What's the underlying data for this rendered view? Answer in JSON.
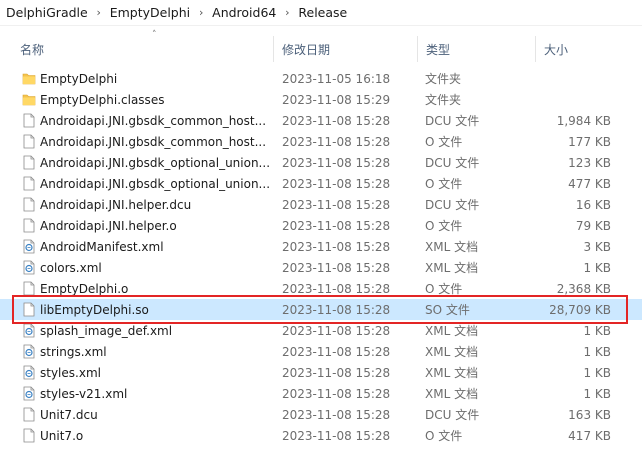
{
  "breadcrumb": [
    "DelphiGradle",
    "EmptyDelphi",
    "Android64",
    "Release"
  ],
  "columns": {
    "name": "名称",
    "date": "修改日期",
    "type": "类型",
    "size": "大小"
  },
  "files": [
    {
      "name": "EmptyDelphi",
      "date": "2023-11-05 16:18",
      "type": "文件夹",
      "size": "",
      "icon": "folder-icon"
    },
    {
      "name": "EmptyDelphi.classes",
      "date": "2023-11-08 15:29",
      "type": "文件夹",
      "size": "",
      "icon": "folder-icon"
    },
    {
      "name": "Androidapi.JNI.gbsdk_common_host...",
      "date": "2023-11-08 15:28",
      "type": "DCU 文件",
      "size": "1,984 KB",
      "icon": "file-icon"
    },
    {
      "name": "Androidapi.JNI.gbsdk_common_host...",
      "date": "2023-11-08 15:28",
      "type": "O 文件",
      "size": "177 KB",
      "icon": "file-icon"
    },
    {
      "name": "Androidapi.JNI.gbsdk_optional_union...",
      "date": "2023-11-08 15:28",
      "type": "DCU 文件",
      "size": "123 KB",
      "icon": "file-icon"
    },
    {
      "name": "Androidapi.JNI.gbsdk_optional_union...",
      "date": "2023-11-08 15:28",
      "type": "O 文件",
      "size": "477 KB",
      "icon": "file-icon"
    },
    {
      "name": "Androidapi.JNI.helper.dcu",
      "date": "2023-11-08 15:28",
      "type": "DCU 文件",
      "size": "16 KB",
      "icon": "file-icon"
    },
    {
      "name": "Androidapi.JNI.helper.o",
      "date": "2023-11-08 15:28",
      "type": "O 文件",
      "size": "79 KB",
      "icon": "file-icon"
    },
    {
      "name": "AndroidManifest.xml",
      "date": "2023-11-08 15:28",
      "type": "XML 文档",
      "size": "3 KB",
      "icon": "xml-file-icon"
    },
    {
      "name": "colors.xml",
      "date": "2023-11-08 15:28",
      "type": "XML 文档",
      "size": "1 KB",
      "icon": "xml-file-icon"
    },
    {
      "name": "EmptyDelphi.o",
      "date": "2023-11-08 15:28",
      "type": "O 文件",
      "size": "2,368 KB",
      "icon": "file-icon"
    },
    {
      "name": "libEmptyDelphi.so",
      "date": "2023-11-08 15:28",
      "type": "SO 文件",
      "size": "28,709 KB",
      "icon": "file-icon",
      "selected": true
    },
    {
      "name": "splash_image_def.xml",
      "date": "2023-11-08 15:28",
      "type": "XML 文档",
      "size": "1 KB",
      "icon": "xml-file-icon"
    },
    {
      "name": "strings.xml",
      "date": "2023-11-08 15:28",
      "type": "XML 文档",
      "size": "1 KB",
      "icon": "xml-file-icon"
    },
    {
      "name": "styles.xml",
      "date": "2023-11-08 15:28",
      "type": "XML 文档",
      "size": "1 KB",
      "icon": "xml-file-icon"
    },
    {
      "name": "styles-v21.xml",
      "date": "2023-11-08 15:28",
      "type": "XML 文档",
      "size": "1 KB",
      "icon": "xml-file-icon"
    },
    {
      "name": "Unit7.dcu",
      "date": "2023-11-08 15:28",
      "type": "DCU 文件",
      "size": "163 KB",
      "icon": "file-icon"
    },
    {
      "name": "Unit7.o",
      "date": "2023-11-08 15:28",
      "type": "O 文件",
      "size": "417 KB",
      "icon": "file-icon"
    }
  ],
  "colors": {
    "selection": "#cce8ff",
    "highlight_border": "#e32525",
    "folder": "#f4c34f",
    "header_text": "#4c607a"
  }
}
